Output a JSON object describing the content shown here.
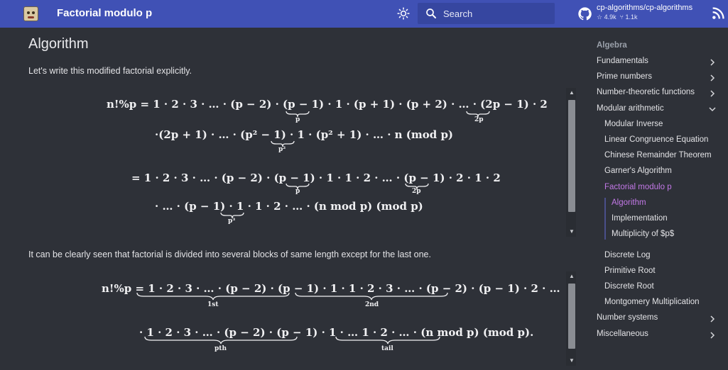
{
  "header": {
    "site_title": "Factorial modulo p",
    "search_placeholder": "Search",
    "repo_name": "cp-algorithms/cp-algorithms",
    "repo_stars": "4.9k",
    "repo_forks": "1.1k"
  },
  "content": {
    "heading": "Algorithm",
    "intro": "Let's write this modified factorial explicitly.",
    "middle": "It can be clearly seen that factorial is divided into several blocks of same length except for the last one.",
    "eq1_line1": "n!%p = 1 · 2 · 3 · … · (p − 2) · (p − 1) · 1 · (p + 1) · (p + 2) · … · (2p − 1) · 2",
    "eq1_line2": "·(2p + 1) · … · (p² − 1) · 1 · (p² + 1) · … · n   (mod p)",
    "eq1_line3": "= 1 · 2 · 3 · … · (p − 2) · (p − 1) · 1 · 1 · 2 · … · (p − 1) · 2 · 1 · 2",
    "eq1_line4": "· … · (p − 1) · 1 · 1 · 2 · … · (n mod p)   (mod p)",
    "eq2_line1": "n!%p = 1 · 2 · 3 · … · (p − 2) · (p − 1) · 1 · 1 · 2 · 3 · … · (p − 2) · (p − 1) · 2 · …",
    "eq2_line2": "· 1 · 2 · 3 · … · (p − 2) · (p − 1) · 1 · …   1 · 2 · … · (n mod p)   (mod p).",
    "sub_p": "p",
    "sub_2p": "2p",
    "sub_p2": "p²",
    "sub_p3": "p³",
    "sub_1st": "1st",
    "sub_2nd": "2nd",
    "sub_pth": "pth",
    "sub_tail": "tail"
  },
  "nav": {
    "section": "Algebra",
    "items": [
      {
        "label": "Fundamentals"
      },
      {
        "label": "Prime numbers"
      },
      {
        "label": "Number-theoretic functions"
      },
      {
        "label": "Modular arithmetic"
      },
      {
        "label": "Modular Inverse"
      },
      {
        "label": "Linear Congruence Equation"
      },
      {
        "label": "Chinese Remainder Theorem"
      },
      {
        "label": "Garner's Algorithm"
      },
      {
        "label": "Factorial modulo p"
      },
      {
        "label": "Algorithm"
      },
      {
        "label": "Implementation"
      },
      {
        "label": "Multiplicity of $p$"
      },
      {
        "label": "Discrete Log"
      },
      {
        "label": "Primitive Root"
      },
      {
        "label": "Discrete Root"
      },
      {
        "label": "Montgomery Multiplication"
      },
      {
        "label": "Number systems"
      },
      {
        "label": "Miscellaneous"
      }
    ]
  },
  "colors": {
    "header_bg": "#4051b5",
    "page_bg": "#2e3138",
    "active_link": "#c278e6"
  }
}
